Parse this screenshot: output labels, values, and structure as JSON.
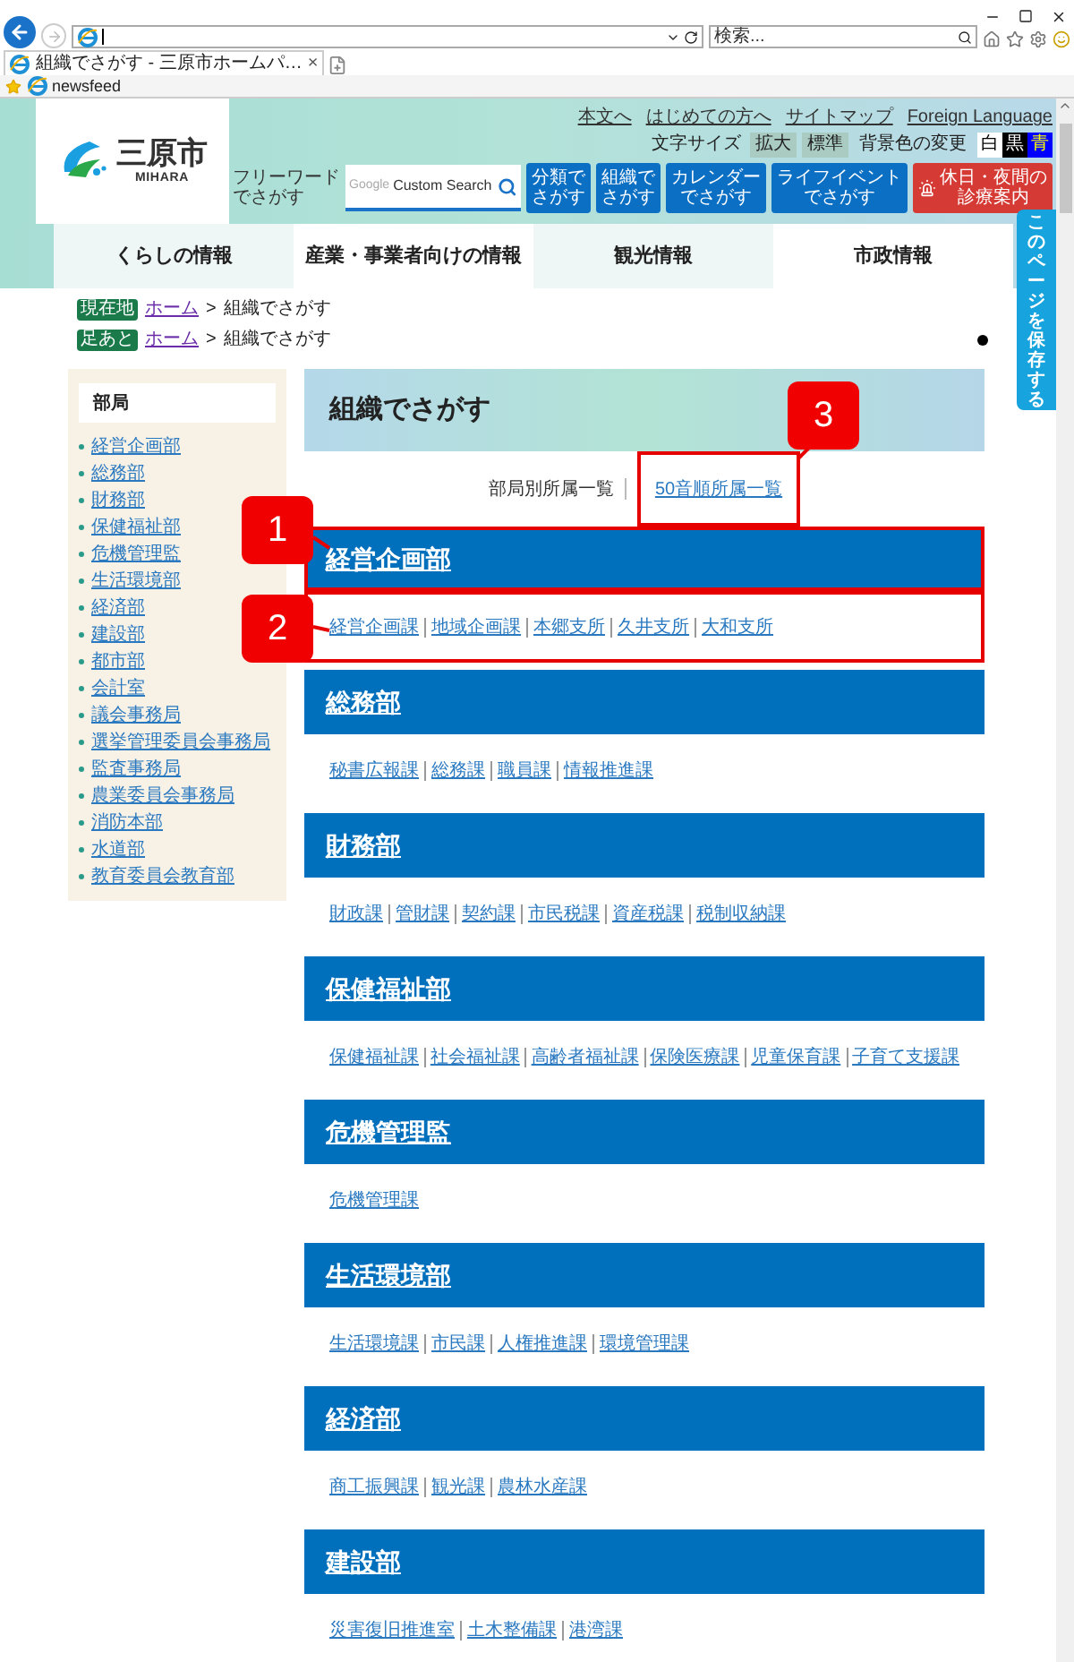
{
  "browser": {
    "tab_title": "組織でさがす - 三原市ホームパ…",
    "tab_close": "×",
    "search_placeholder": "検索...",
    "favorites": [
      {
        "label": "newsfeed"
      }
    ]
  },
  "header": {
    "logo": {
      "name": "三原市",
      "romaji": "MIHARA"
    },
    "utility_links": [
      "本文へ",
      "はじめての方へ",
      "サイトマップ",
      "Foreign Language"
    ],
    "text_size": {
      "label": "文字サイズ",
      "options": [
        "拡大",
        "標準"
      ]
    },
    "background_color": {
      "label": "背景色の変更",
      "options": [
        {
          "label": "白",
          "color": "#ffffff"
        },
        {
          "label": "黒",
          "color": "#000000"
        },
        {
          "label": "青",
          "color": "#0000ff"
        }
      ]
    },
    "search": {
      "label_lines": [
        "フリーワード",
        "でさがす"
      ],
      "brand": "Google",
      "placeholder": "Custom Search"
    },
    "buttons": [
      {
        "lines": [
          "分類で",
          "さがす"
        ],
        "kind": "normal"
      },
      {
        "lines": [
          "組織で",
          "さがす"
        ],
        "kind": "normal"
      },
      {
        "lines": [
          "カレンダー",
          "でさがす"
        ],
        "kind": "normal"
      },
      {
        "lines": [
          "ライフイベント",
          "でさがす"
        ],
        "kind": "normal"
      },
      {
        "lines": [
          "休日・夜間の",
          "診療案内"
        ],
        "kind": "emergency"
      }
    ]
  },
  "nav": [
    "くらしの情報",
    "産業・事業者向けの情報",
    "観光情報",
    "市政情報"
  ],
  "save_tab": "このページを保存する",
  "breadcrumbs": {
    "separator": ">",
    "rows": [
      {
        "badge": "現在地",
        "home": "ホーム",
        "current": "組織でさがす"
      },
      {
        "badge": "足あと",
        "home": "ホーム",
        "current": "組織でさがす"
      }
    ]
  },
  "sidebar": {
    "title": "部局",
    "items": [
      "経営企画部",
      "総務部",
      "財務部",
      "保健福祉部",
      "危機管理監",
      "生活環境部",
      "経済部",
      "建設部",
      "都市部",
      "会計室",
      "議会事務局",
      "選挙管理委員会事務局",
      "監査事務局",
      "農業委員会事務局",
      "消防本部",
      "水道部",
      "教育委員会教育部"
    ]
  },
  "main": {
    "title": "組織でさがす",
    "views": [
      {
        "label": "部局別所属一覧",
        "selected": true,
        "highlighted": false
      },
      {
        "label": "50音順所属一覧",
        "selected": false,
        "highlighted": true
      }
    ],
    "sections": [
      {
        "name": "経営企画部",
        "highlighted": true,
        "links": [
          "経営企画課",
          "地域企画課",
          "本郷支所",
          "久井支所",
          "大和支所"
        ]
      },
      {
        "name": "総務部",
        "highlighted": false,
        "links": [
          "秘書広報課",
          "総務課",
          "職員課",
          "情報推進課"
        ]
      },
      {
        "name": "財務部",
        "highlighted": false,
        "links": [
          "財政課",
          "管財課",
          "契約課",
          "市民税課",
          "資産税課",
          "税制収納課"
        ]
      },
      {
        "name": "保健福祉部",
        "highlighted": false,
        "links": [
          "保健福祉課",
          "社会福祉課",
          "高齢者福祉課",
          "保険医療課",
          "児童保育課",
          "子育て支援課"
        ]
      },
      {
        "name": "危機管理監",
        "highlighted": false,
        "links": [
          "危機管理課"
        ]
      },
      {
        "name": "生活環境部",
        "highlighted": false,
        "links": [
          "生活環境課",
          "市民課",
          "人権推進課",
          "環境管理課"
        ]
      },
      {
        "name": "経済部",
        "highlighted": false,
        "links": [
          "商工振興課",
          "観光課",
          "農林水産課"
        ]
      },
      {
        "name": "建設部",
        "highlighted": false,
        "links": [
          "災害復旧推進室",
          "土木整備課",
          "港湾課"
        ]
      }
    ]
  },
  "annotations": [
    {
      "label": "1"
    },
    {
      "label": "2"
    },
    {
      "label": "3"
    }
  ]
}
